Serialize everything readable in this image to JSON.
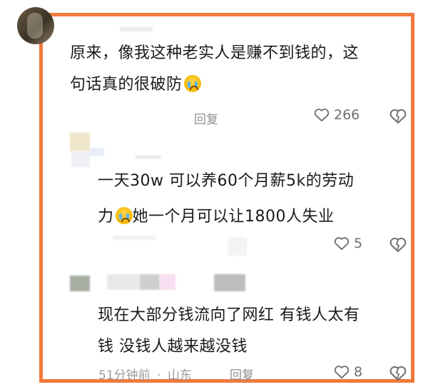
{
  "comments": [
    {
      "text_line1": "原来，像我这种老实人是赚不到钱的，这",
      "text_line2": "句话真的很破防",
      "reply_label": "回复",
      "like_count": "266"
    },
    {
      "text_line1": "一天30w  可以养60个月薪5k的劳动",
      "text_line2_pre": "力",
      "text_line2_post": "她一个月可以让1800人失业",
      "like_count": "5"
    },
    {
      "text_line1": "现在大部分钱流向了网红 有钱人太有",
      "text_line2": "钱 没钱人越来越没钱",
      "time": "51分钟前",
      "location": "山东",
      "separator": "·",
      "reply_label": "回复",
      "like_count": "8"
    }
  ],
  "colors": {
    "frame": "#f07a3c",
    "meta": "#8f8f8f"
  },
  "icons": [
    "heart-outline-icon",
    "dislike-heart-icon",
    "crying-emoji-icon"
  ]
}
